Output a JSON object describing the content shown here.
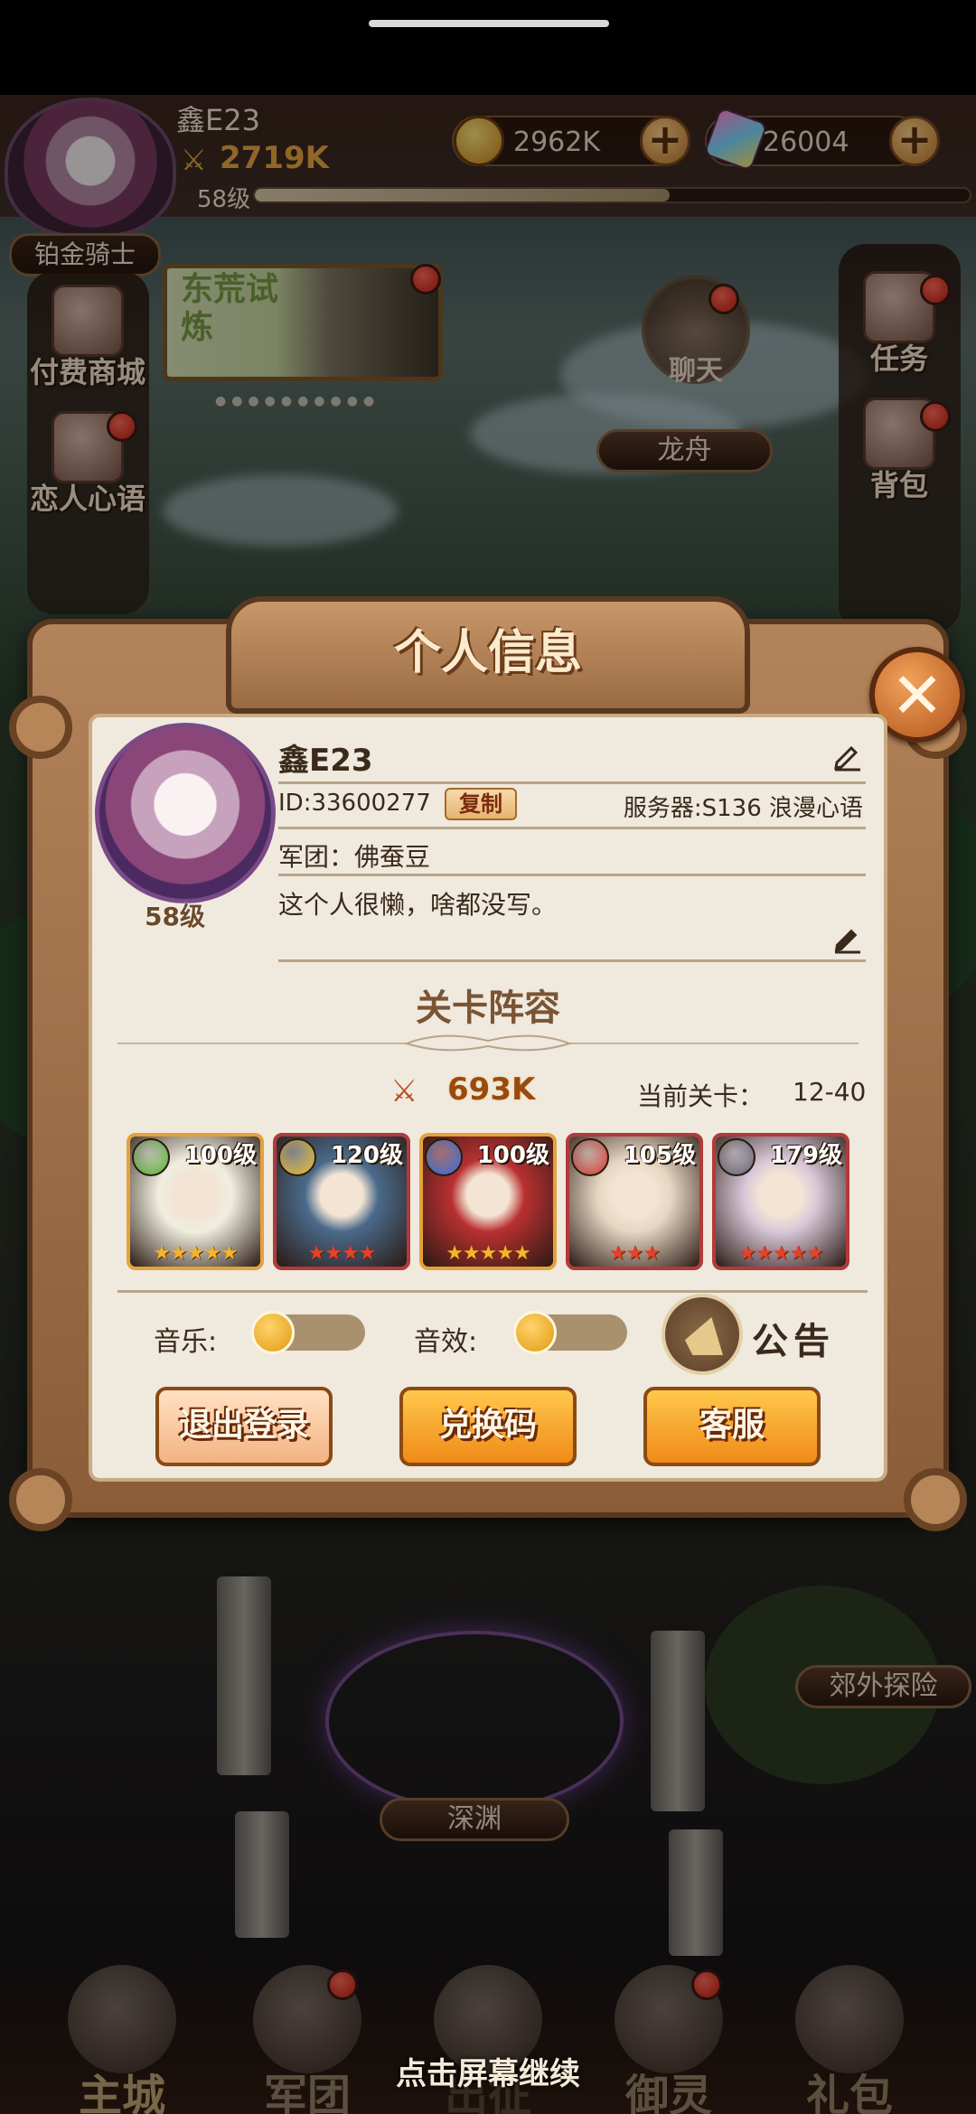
{
  "hud": {
    "player_name": "鑫E23",
    "power": "2719K",
    "level": "58级",
    "xp_progress": 0.58,
    "gold": "2962K",
    "gems": "26004",
    "rank": "铂金骑士"
  },
  "sidebar_left": {
    "items": [
      {
        "label": "付费商城",
        "icon": "gift-shop-icon"
      },
      {
        "label": "恋人心语",
        "icon": "lover-icon"
      }
    ]
  },
  "sidebar_right": {
    "items": [
      {
        "label": "任务",
        "icon": "quest-icon"
      },
      {
        "label": "背包",
        "icon": "backpack-icon"
      }
    ]
  },
  "event_card": {
    "title": "东荒试炼"
  },
  "world": {
    "chat": "聊天",
    "dragon_boat": "龙舟",
    "explore": "郊外探险",
    "abyss": "深渊"
  },
  "bottom_nav": {
    "items": [
      "主城",
      "军团",
      "出征",
      "御灵",
      "礼包"
    ],
    "continue_hint": "点击屏幕继续"
  },
  "profile": {
    "title": "个人信息",
    "name": "鑫E23",
    "id_text": "ID:33600277",
    "copy_label": "复制",
    "server": "服务器:S136 浪漫心语",
    "legion": "军团：佛蚕豆",
    "signature": "这个人很懒，啥都没写。",
    "level": "58级",
    "lineup_title": "关卡阵容",
    "lineup_power": "693K",
    "stage_label": "当前关卡：",
    "stage_value": "12-40",
    "heroes": [
      {
        "level": "100级",
        "stars": 5,
        "star_color": "#f4b52a",
        "element": "#49a82a",
        "bg": "#f0eedf",
        "frame": "#e4a23a"
      },
      {
        "level": "120级",
        "stars": 4,
        "star_color": "#e8402a",
        "element": "#e8b62a",
        "bg": "#4a6a8a",
        "frame": "#b23a3a"
      },
      {
        "level": "100级",
        "stars": 5,
        "star_color": "#f4b52a",
        "element": "#2a6ad8",
        "bg": "#b83030",
        "frame": "#e4a23a"
      },
      {
        "level": "105级",
        "stars": 3,
        "star_color": "#e8402a",
        "element": "#c8302a",
        "bg": "#e6d6c2",
        "frame": "#b23a3a"
      },
      {
        "level": "179级",
        "stars": 5,
        "star_color": "#e8402a",
        "element": "#5a5a6a",
        "bg": "#d8c8d8",
        "frame": "#b23a3a"
      }
    ],
    "music_label": "音乐:",
    "sfx_label": "音效:",
    "notice_label": "公告",
    "logout_label": "退出登录",
    "redeem_label": "兑换码",
    "service_label": "客服"
  }
}
